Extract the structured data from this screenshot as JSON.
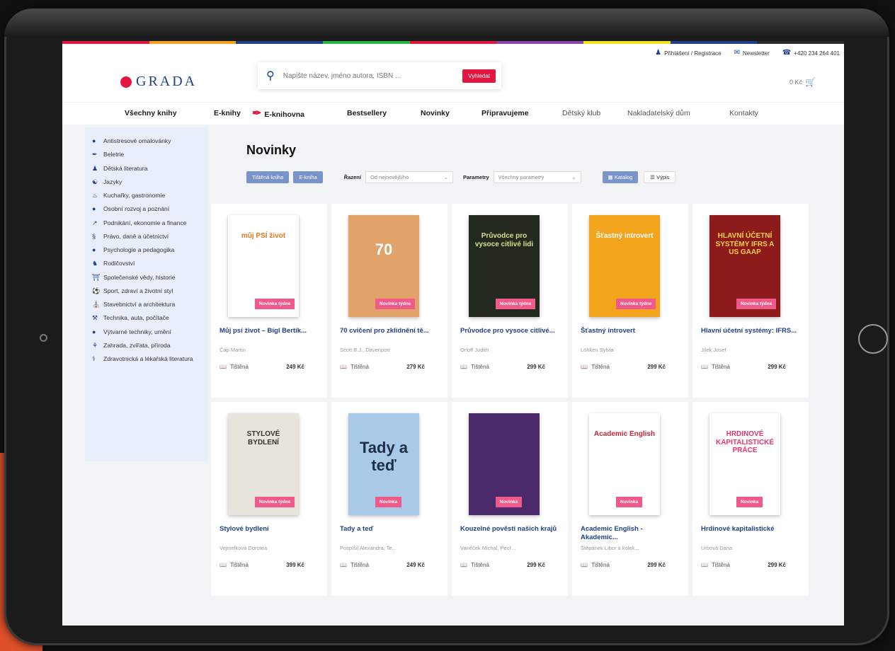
{
  "topbar": {
    "login": "Přihlášení / Registrace",
    "newsletter": "Newsletter",
    "phone": "+420 234 264 401"
  },
  "header": {
    "logo": "GRADA",
    "search_placeholder": "Napište název, jméno autora, ISBN ...",
    "search_button": "Vyhledat",
    "cart": "0 Kč"
  },
  "nav": [
    "Všechny knihy",
    "E-knihy",
    "E-knihovna",
    "Bestsellery",
    "Novinky",
    "Připravujeme",
    "Dětský klub",
    "Nakladatelský dům",
    "Kontakty"
  ],
  "categories": [
    "Antistresové omalovánky",
    "Beletrie",
    "Dětská literatura",
    "Jazyky",
    "Kuchařky, gastronomie",
    "Osobní rozvoj a poznání",
    "Podnikání, ekonomie a finance",
    "Právo, daně a účetnictví",
    "Psychologie a pedagogika",
    "Rodičovství",
    "Společenské vědy, historie",
    "Sport, zdraví a životní styl",
    "Stavebnictví a architektura",
    "Technika, auta, počítače",
    "Výtvarné techniky, umění",
    "Zahrada, zvířata, příroda",
    "Zdravotnická a lékařská literatura"
  ],
  "page": {
    "title": "Novinky",
    "filter_print": "Tištěná kniha",
    "filter_ebook": "E-kniha",
    "sort_label": "Řazení",
    "sort_value": "Od nejnovějšího",
    "params_label": "Parametry",
    "params_value": "Všechny parametry",
    "view_catalog": "Katalog",
    "view_list": "Výpis"
  },
  "books": [
    {
      "title": "Můj psí život – Bígl Bertík...",
      "author": "Čáp Martin",
      "format": "Tištěná",
      "price": "249 Kč",
      "badge": "Novinka týdne",
      "cover_text": "můj PSÍ život",
      "cover_bg": "#ffffff",
      "cover_fg": "#e0781e"
    },
    {
      "title": "70 cvičení pro zklidnění tě...",
      "author": "Scott B.J., Davenport",
      "format": "Tištěná",
      "price": "279 Kč",
      "badge": "Novinka týdne",
      "cover_text": "70",
      "cover_bg": "#e2a36b",
      "cover_fg": "#ffffff"
    },
    {
      "title": "Průvodce pro vysoce citlivé...",
      "author": "Orloff Judith",
      "format": "Tištěná",
      "price": "299 Kč",
      "badge": "Novinka týdne",
      "cover_text": "Průvodce pro vysoce citlivé lidi",
      "cover_bg": "#23291f",
      "cover_fg": "#d7e08a"
    },
    {
      "title": "Šťastný introvert",
      "author": "Löhken Sylvia",
      "format": "Tištěná",
      "price": "299 Kč",
      "badge": "Novinka týdne",
      "cover_text": "Šťastný introvert",
      "cover_bg": "#f2a51c",
      "cover_fg": "#ffffff"
    },
    {
      "title": "Hlavní účetní systémy: IFRS...",
      "author": "Jílek Josef",
      "format": "Tištěná",
      "price": "299 Kč",
      "badge": "Novinka týdne",
      "cover_text": "HLAVNÍ ÚČETNÍ SYSTÉMY IFRS A US GAAP",
      "cover_bg": "#8e1b1b",
      "cover_fg": "#ffd24a"
    },
    {
      "title": "Stylové bydlení",
      "author": "Vejmelková Dorotea",
      "format": "Tištěná",
      "price": "399 Kč",
      "badge": "Novinka týdne",
      "cover_text": "STYLOVÉ BYDLENÍ",
      "cover_bg": "#e8e4dc",
      "cover_fg": "#333333"
    },
    {
      "title": "Tady a teď",
      "author": "Pospíšil Alexandra, Te...",
      "format": "Tištěná",
      "price": "249 Kč",
      "badge": "Novinka",
      "cover_text": "Tady a teď",
      "cover_bg": "#a9c9e8",
      "cover_fg": "#1d2e45"
    },
    {
      "title": "Kouzelné pověsti našich krajů",
      "author": "Vaněček Michal, Pecř...",
      "format": "Tištěná",
      "price": "299 Kč",
      "badge": "Novinka",
      "cover_text": "",
      "cover_bg": "#4a2a6a",
      "cover_fg": "#ffe066"
    },
    {
      "title": "Academic English - Akademic...",
      "author": "Štěpánek Libor a kolek...",
      "format": "Tištěná",
      "price": "299 Kč",
      "badge": "Novinka",
      "cover_text": "Academic English",
      "cover_bg": "#ffffff",
      "cover_fg": "#c0283a"
    },
    {
      "title": "Hrdinové kapitalistické",
      "author": "Urbová Dana",
      "format": "Tištěná",
      "price": "299 Kč",
      "badge": "Novinka",
      "cover_text": "HRDINOVÉ KAPITALISTICKÉ PRÁCE",
      "cover_bg": "#ffffff",
      "cover_fg": "#e8356c"
    }
  ],
  "colors": {
    "brand_blue": "#1e3f8a",
    "brand_red": "#e3163f",
    "badge_pink": "#f05a8a"
  }
}
